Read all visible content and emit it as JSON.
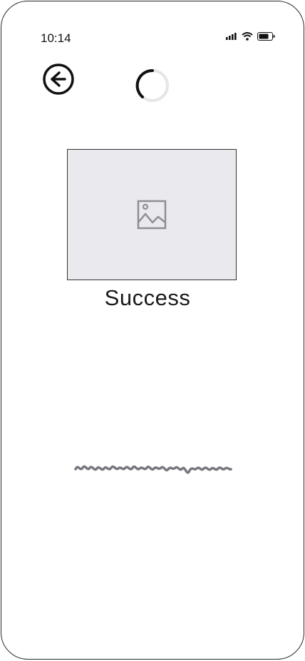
{
  "status_bar": {
    "time": "10:14",
    "icons": [
      "signal-icon",
      "wifi-icon",
      "battery-icon"
    ]
  },
  "header": {
    "back_icon": "arrow-left-circle-icon",
    "loading_icon": "spinner-icon"
  },
  "main": {
    "image_placeholder_icon": "image-icon",
    "title": "Success",
    "placeholder_text_icon": "scribble-text-placeholder"
  },
  "colors": {
    "text": "#1a1a1a",
    "placeholder_bg": "#e9e9ee",
    "icon_gray": "#8e8e93",
    "spinner_track": "#e6e6e6"
  }
}
